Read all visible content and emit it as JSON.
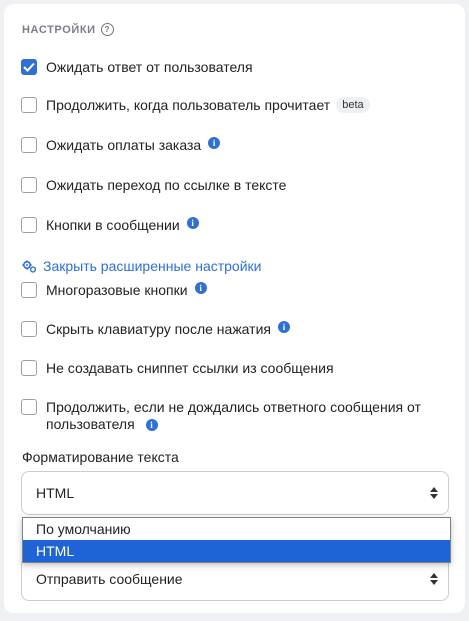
{
  "section": {
    "title": "НАСТРОЙКИ",
    "help_icon": "?"
  },
  "checkboxes": [
    {
      "label": "Ожидать ответ от пользователя",
      "checked": true
    },
    {
      "label": "Продолжить, когда пользователь прочитает",
      "badge": "beta",
      "checked": false
    },
    {
      "label": "Ожидать оплаты заказа",
      "info": true,
      "checked": false
    },
    {
      "label": "Ожидать переход по ссылке в тексте",
      "checked": false
    },
    {
      "label": "Кнопки в сообщении",
      "info": true,
      "checked": false
    },
    {
      "label": "Многоразовые кнопки",
      "info": true,
      "checked": false
    },
    {
      "label": "Скрыть клавиатуру после нажатия",
      "info": true,
      "checked": false
    },
    {
      "label": "Не создавать сниппет ссылки из сообщения",
      "checked": false
    },
    {
      "label_line1": "Продолжить, если не дождались ответного сообщения от",
      "label_line2": "пользователя",
      "info": true,
      "checked": false
    }
  ],
  "advanced_link": {
    "label": "Закрыть расширенные настройки",
    "icon": "gears-icon"
  },
  "formatting": {
    "label": "Форматирование текста",
    "selected": "HTML",
    "options": [
      "По умолчанию",
      "HTML"
    ]
  },
  "action_select": {
    "value": "Отправить сообщение"
  },
  "colors": {
    "accent": "#2f6fd6",
    "selected_option": "#1e64d6"
  }
}
